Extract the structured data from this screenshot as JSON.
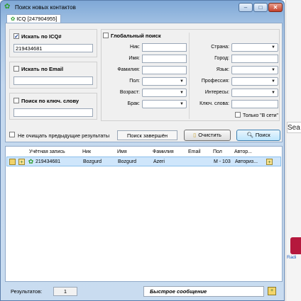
{
  "window": {
    "title": "Поиск новых контактов"
  },
  "tab": {
    "label": "ICQ [247904955]"
  },
  "icq_group": {
    "label": "Искать по ICQ#",
    "checked": true,
    "value": "219434681"
  },
  "email_group": {
    "label": "Искать по Email",
    "value": ""
  },
  "keyword_group": {
    "label": "Поиск по ключ. слову",
    "value": ""
  },
  "global_search": {
    "label": "Глобальный поиск",
    "nick_label": "Ник:",
    "firstname_label": "Имя:",
    "lastname_label": "Фамилия:",
    "sex_label": "Пол:",
    "age_label": "Возраст:",
    "marital_label": "Брак:",
    "country_label": "Страна:",
    "city_label": "Город:",
    "language_label": "Язык:",
    "profession_label": "Профессия:",
    "interests_label": "Интересы:",
    "keywords_label": "Ключ. слова:",
    "online_only_label": "Только \"В сети\""
  },
  "controls": {
    "keep_results_label": "Не очищать предыдущие результаты",
    "status": "Поиск завершён",
    "clear_button": "Очистить",
    "search_button": "Поиск"
  },
  "results": {
    "columns": [
      "Учётная запись",
      "Ник",
      "Имя",
      "Фамилия",
      "Email",
      "Пол",
      "Автор..."
    ],
    "rows": [
      {
        "account": "219434681",
        "nick": "Bozgurd",
        "first_name": "Bozgurd",
        "last_name": "Azeri",
        "email": "",
        "sex_age": "M - 103",
        "auth": "Авториз..."
      }
    ]
  },
  "bottom": {
    "results_label": "Результатов:",
    "results_count": "1",
    "quick_message": "Быстрое сообщение"
  },
  "background": {
    "search_fragment": "Sea",
    "radio_fragment": "Radi"
  }
}
